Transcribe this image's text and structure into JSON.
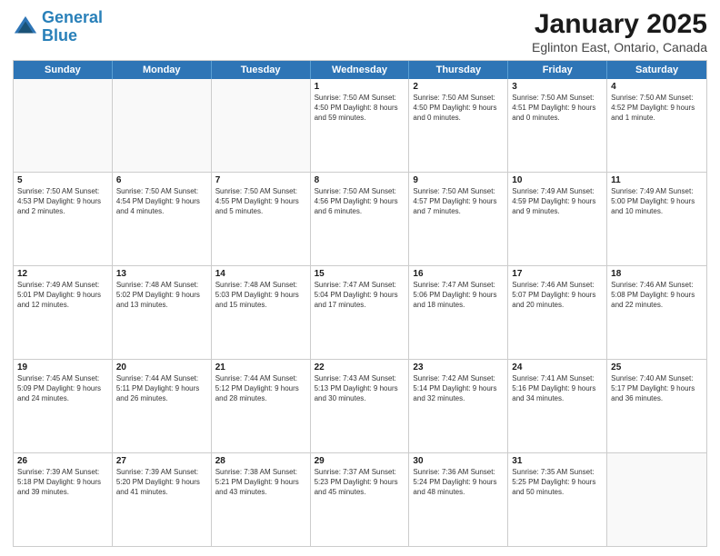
{
  "header": {
    "logo_line1": "General",
    "logo_line2": "Blue",
    "title": "January 2025",
    "subtitle": "Eglinton East, Ontario, Canada"
  },
  "days": [
    "Sunday",
    "Monday",
    "Tuesday",
    "Wednesday",
    "Thursday",
    "Friday",
    "Saturday"
  ],
  "weeks": [
    [
      {
        "day": "",
        "info": ""
      },
      {
        "day": "",
        "info": ""
      },
      {
        "day": "",
        "info": ""
      },
      {
        "day": "1",
        "info": "Sunrise: 7:50 AM\nSunset: 4:50 PM\nDaylight: 8 hours\nand 59 minutes."
      },
      {
        "day": "2",
        "info": "Sunrise: 7:50 AM\nSunset: 4:50 PM\nDaylight: 9 hours\nand 0 minutes."
      },
      {
        "day": "3",
        "info": "Sunrise: 7:50 AM\nSunset: 4:51 PM\nDaylight: 9 hours\nand 0 minutes."
      },
      {
        "day": "4",
        "info": "Sunrise: 7:50 AM\nSunset: 4:52 PM\nDaylight: 9 hours\nand 1 minute."
      }
    ],
    [
      {
        "day": "5",
        "info": "Sunrise: 7:50 AM\nSunset: 4:53 PM\nDaylight: 9 hours\nand 2 minutes."
      },
      {
        "day": "6",
        "info": "Sunrise: 7:50 AM\nSunset: 4:54 PM\nDaylight: 9 hours\nand 4 minutes."
      },
      {
        "day": "7",
        "info": "Sunrise: 7:50 AM\nSunset: 4:55 PM\nDaylight: 9 hours\nand 5 minutes."
      },
      {
        "day": "8",
        "info": "Sunrise: 7:50 AM\nSunset: 4:56 PM\nDaylight: 9 hours\nand 6 minutes."
      },
      {
        "day": "9",
        "info": "Sunrise: 7:50 AM\nSunset: 4:57 PM\nDaylight: 9 hours\nand 7 minutes."
      },
      {
        "day": "10",
        "info": "Sunrise: 7:49 AM\nSunset: 4:59 PM\nDaylight: 9 hours\nand 9 minutes."
      },
      {
        "day": "11",
        "info": "Sunrise: 7:49 AM\nSunset: 5:00 PM\nDaylight: 9 hours\nand 10 minutes."
      }
    ],
    [
      {
        "day": "12",
        "info": "Sunrise: 7:49 AM\nSunset: 5:01 PM\nDaylight: 9 hours\nand 12 minutes."
      },
      {
        "day": "13",
        "info": "Sunrise: 7:48 AM\nSunset: 5:02 PM\nDaylight: 9 hours\nand 13 minutes."
      },
      {
        "day": "14",
        "info": "Sunrise: 7:48 AM\nSunset: 5:03 PM\nDaylight: 9 hours\nand 15 minutes."
      },
      {
        "day": "15",
        "info": "Sunrise: 7:47 AM\nSunset: 5:04 PM\nDaylight: 9 hours\nand 17 minutes."
      },
      {
        "day": "16",
        "info": "Sunrise: 7:47 AM\nSunset: 5:06 PM\nDaylight: 9 hours\nand 18 minutes."
      },
      {
        "day": "17",
        "info": "Sunrise: 7:46 AM\nSunset: 5:07 PM\nDaylight: 9 hours\nand 20 minutes."
      },
      {
        "day": "18",
        "info": "Sunrise: 7:46 AM\nSunset: 5:08 PM\nDaylight: 9 hours\nand 22 minutes."
      }
    ],
    [
      {
        "day": "19",
        "info": "Sunrise: 7:45 AM\nSunset: 5:09 PM\nDaylight: 9 hours\nand 24 minutes."
      },
      {
        "day": "20",
        "info": "Sunrise: 7:44 AM\nSunset: 5:11 PM\nDaylight: 9 hours\nand 26 minutes."
      },
      {
        "day": "21",
        "info": "Sunrise: 7:44 AM\nSunset: 5:12 PM\nDaylight: 9 hours\nand 28 minutes."
      },
      {
        "day": "22",
        "info": "Sunrise: 7:43 AM\nSunset: 5:13 PM\nDaylight: 9 hours\nand 30 minutes."
      },
      {
        "day": "23",
        "info": "Sunrise: 7:42 AM\nSunset: 5:14 PM\nDaylight: 9 hours\nand 32 minutes."
      },
      {
        "day": "24",
        "info": "Sunrise: 7:41 AM\nSunset: 5:16 PM\nDaylight: 9 hours\nand 34 minutes."
      },
      {
        "day": "25",
        "info": "Sunrise: 7:40 AM\nSunset: 5:17 PM\nDaylight: 9 hours\nand 36 minutes."
      }
    ],
    [
      {
        "day": "26",
        "info": "Sunrise: 7:39 AM\nSunset: 5:18 PM\nDaylight: 9 hours\nand 39 minutes."
      },
      {
        "day": "27",
        "info": "Sunrise: 7:39 AM\nSunset: 5:20 PM\nDaylight: 9 hours\nand 41 minutes."
      },
      {
        "day": "28",
        "info": "Sunrise: 7:38 AM\nSunset: 5:21 PM\nDaylight: 9 hours\nand 43 minutes."
      },
      {
        "day": "29",
        "info": "Sunrise: 7:37 AM\nSunset: 5:23 PM\nDaylight: 9 hours\nand 45 minutes."
      },
      {
        "day": "30",
        "info": "Sunrise: 7:36 AM\nSunset: 5:24 PM\nDaylight: 9 hours\nand 48 minutes."
      },
      {
        "day": "31",
        "info": "Sunrise: 7:35 AM\nSunset: 5:25 PM\nDaylight: 9 hours\nand 50 minutes."
      },
      {
        "day": "",
        "info": ""
      }
    ]
  ]
}
